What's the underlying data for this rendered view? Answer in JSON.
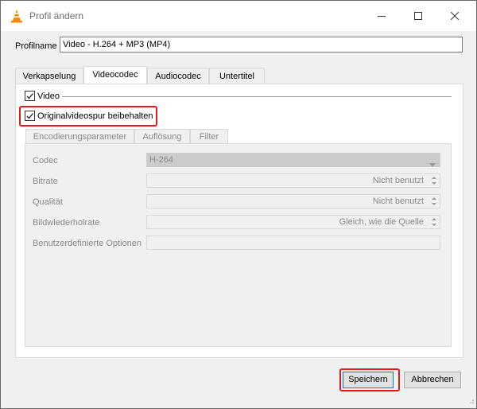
{
  "window": {
    "title": "Profil ändern",
    "minimize_icon": "minimize-icon",
    "maximize_icon": "maximize-icon",
    "close_icon": "close-icon"
  },
  "profile": {
    "label": "Profilname",
    "value": "Video - H.264 + MP3 (MP4)"
  },
  "tabs": [
    {
      "label": "Verkapselung",
      "active": false
    },
    {
      "label": "Videocodec",
      "active": true
    },
    {
      "label": "Audiocodec",
      "active": false
    },
    {
      "label": "Untertitel",
      "active": false
    }
  ],
  "video": {
    "label": "Video",
    "checked": true
  },
  "keep_original": {
    "label": "Originalvideospur beibehalten",
    "checked": true
  },
  "subtabs": [
    {
      "label": "Encodierungsparameter",
      "active": true
    },
    {
      "label": "Auflösung",
      "active": false
    },
    {
      "label": "Filter",
      "active": false
    }
  ],
  "fields": [
    {
      "label": "Codec",
      "value": "H-264",
      "kind": "combo"
    },
    {
      "label": "Bitrate",
      "value": "Nicht benutzt",
      "kind": "spin"
    },
    {
      "label": "Qualität",
      "value": "Nicht benutzt",
      "kind": "spin"
    },
    {
      "label": "Bildwiederholrate",
      "value": "Gleich, wie die Quelle",
      "kind": "spin"
    },
    {
      "label": "Benutzerdefinierte Optionen",
      "value": "",
      "kind": "text"
    }
  ],
  "buttons": {
    "save": "Speichern",
    "cancel": "Abbrechen"
  },
  "colors": {
    "highlight": "#e01b1b",
    "disabled_text": "#8a8a8a",
    "vlc_orange": "#f48b00"
  }
}
